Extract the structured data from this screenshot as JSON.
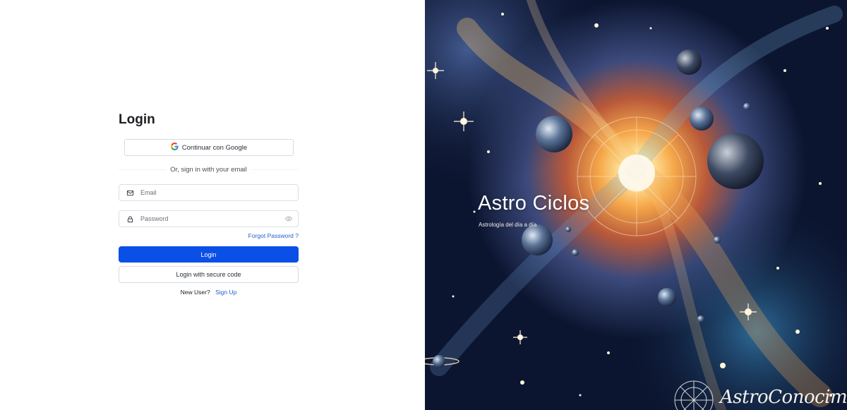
{
  "login": {
    "title": "Login",
    "google_button": "Continuar con Google",
    "divider_text": "Or, sign in with your email",
    "email_placeholder": "Email",
    "password_placeholder": "Password",
    "forgot_password": "Forgot Password ?",
    "login_button": "Login",
    "secure_code_button": "Login with secure code",
    "new_user_text": "New User?",
    "signup_link": "Sign Up"
  },
  "hero": {
    "brand": "Astro Ciclos",
    "tagline": "Astrología del día a día",
    "signature": "AstroConocimiento"
  },
  "icons": {
    "google": "google-icon",
    "email": "mail-icon",
    "password": "lock-icon",
    "reveal": "eye-icon"
  },
  "colors": {
    "primary": "#0a4fe6",
    "link": "#1f5fc9",
    "hero_background": "#0d1630"
  }
}
